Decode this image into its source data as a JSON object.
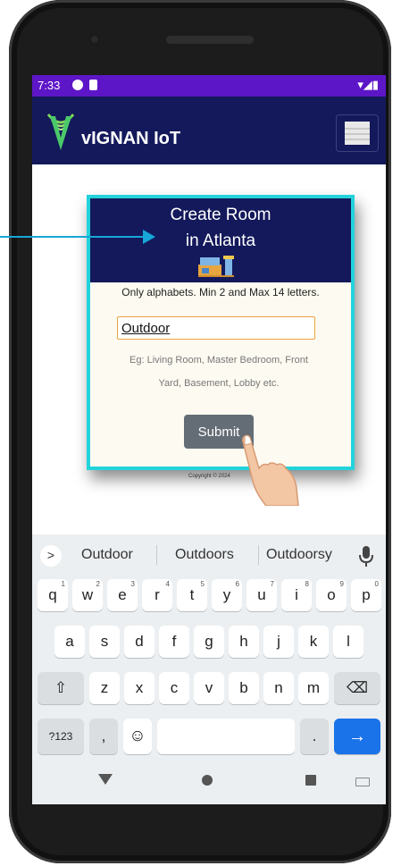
{
  "status_bar": {
    "time": "7:33",
    "right_icons": "▾◢▮"
  },
  "app": {
    "brand": "vIGNAN IoT"
  },
  "card": {
    "title": "Create Room",
    "subtitle": "in  Atlanta",
    "hint": "Only alphabets. Min 2 and Max 14 letters.",
    "input_value": "Outdoor",
    "example": "Eg: Living Room, Master Bedroom, Front Yard, Basement, Lobby etc.",
    "submit_label": "Submit"
  },
  "copyright": "Copyright © 2024",
  "keyboard": {
    "suggestions": [
      "Outdoor",
      "Outdoors",
      "Outdoorsy"
    ],
    "expand_label": ">",
    "row1": [
      {
        "k": "q",
        "n": "1"
      },
      {
        "k": "w",
        "n": "2"
      },
      {
        "k": "e",
        "n": "3"
      },
      {
        "k": "r",
        "n": "4"
      },
      {
        "k": "t",
        "n": "5"
      },
      {
        "k": "y",
        "n": "6"
      },
      {
        "k": "u",
        "n": "7"
      },
      {
        "k": "i",
        "n": "8"
      },
      {
        "k": "o",
        "n": "9"
      },
      {
        "k": "p",
        "n": "0"
      }
    ],
    "row2": [
      "a",
      "s",
      "d",
      "f",
      "g",
      "h",
      "j",
      "k",
      "l"
    ],
    "row3": [
      "z",
      "x",
      "c",
      "v",
      "b",
      "n",
      "m"
    ],
    "shift_label": "⇧",
    "backspace_label": "⌫",
    "symbols_label": "?123",
    "comma_label": ",",
    "emoji_label": "☺",
    "period_label": ".",
    "enter_label": "→"
  },
  "colors": {
    "status_bar": "#5d16c7",
    "app_bar": "#13195b",
    "card_border": "#22d3db",
    "submit": "#646d75",
    "keyboard_enter": "#1a73e8",
    "annotation_arrow": "#17a6d8"
  }
}
